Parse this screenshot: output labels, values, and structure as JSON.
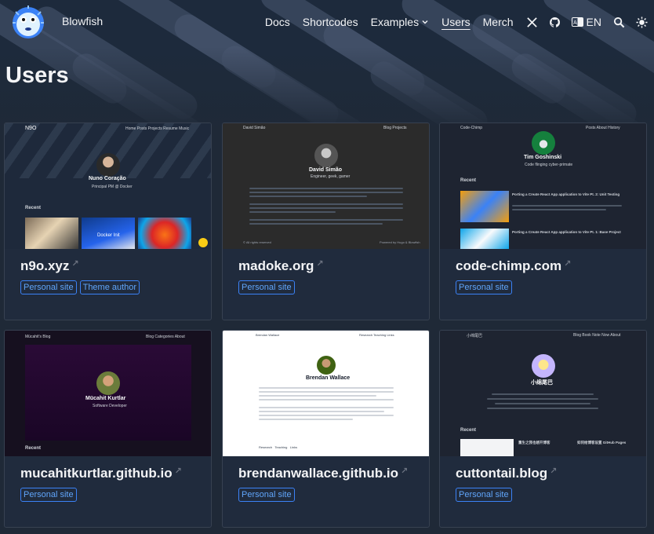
{
  "header": {
    "brand": "Blowfish",
    "nav": [
      {
        "label": "Docs"
      },
      {
        "label": "Shortcodes"
      },
      {
        "label": "Examples"
      },
      {
        "label": "Users"
      },
      {
        "label": "Merch"
      }
    ],
    "lang": "EN",
    "icons": [
      "x-logo-icon",
      "github-icon",
      "translate-icon",
      "search-icon",
      "theme-toggle-icon"
    ]
  },
  "page": {
    "title": "Users"
  },
  "cards": [
    {
      "title": "n9o.xyz",
      "tags": [
        "Personal site",
        "Theme author"
      ],
      "preview": {
        "site": "N9O",
        "name": "Nuno Coração",
        "subtitle": "Principal PM @ Docker",
        "section": "Recent",
        "menu": [
          "Home",
          "Posts",
          "Projects",
          "Resume",
          "Music"
        ],
        "article": "Docker Init"
      }
    },
    {
      "title": "madoke.org",
      "tags": [
        "Personal site"
      ],
      "preview": {
        "site": "David Simão",
        "name": "David Simão",
        "subtitle": "Engineer, geek, gamer",
        "menu": [
          "Blog",
          "Projects"
        ],
        "footer_left": "© All rights reserved",
        "footer_right": "Powered by Hugo & Blowfish"
      }
    },
    {
      "title": "code-chimp.com",
      "tags": [
        "Personal site"
      ],
      "preview": {
        "site": "Code-Chimp",
        "name": "Tim Goshinski",
        "subtitle": "Code flinging cyber-primate",
        "section": "Recent",
        "menu": [
          "Posts",
          "About",
          "History"
        ],
        "posts": [
          "Porting a Create React App application to Vite Pt. 2: Unit Testing",
          "Porting a Create React App application to Vite Pt. 1: Base Project"
        ]
      }
    },
    {
      "title": "mucahitkurtlar.github.io",
      "tags": [
        "Personal site"
      ],
      "preview": {
        "site": "Mücahit's Blog",
        "name": "Mücahit Kurtlar",
        "subtitle": "Software Developer",
        "section": "Recent",
        "menu": [
          "Blog",
          "Categories",
          "About"
        ]
      }
    },
    {
      "title": "brendanwallace.github.io",
      "tags": [
        "Personal site"
      ],
      "preview": {
        "site": "Brendan Wallace",
        "name": "Brendan Wallace",
        "menu": [
          "Research",
          "Teaching",
          "Links"
        ],
        "links": [
          "Research",
          "Teaching",
          "Links"
        ]
      }
    },
    {
      "title": "cuttontail.blog",
      "tags": [
        "Personal site"
      ],
      "preview": {
        "site": "小绵尾巴",
        "name": "小绵尾巴",
        "section": "Recent",
        "menu": [
          "Blog",
          "Book Note",
          "Now",
          "About"
        ],
        "posts": [
          "重生之我也想开博客",
          "如何给博客设置 GitHub Pages"
        ]
      }
    }
  ],
  "colors": {
    "background": "#1f2937",
    "card": "#202b3d",
    "accent": "#3b82f6",
    "tag_text": "#60a5fa"
  }
}
